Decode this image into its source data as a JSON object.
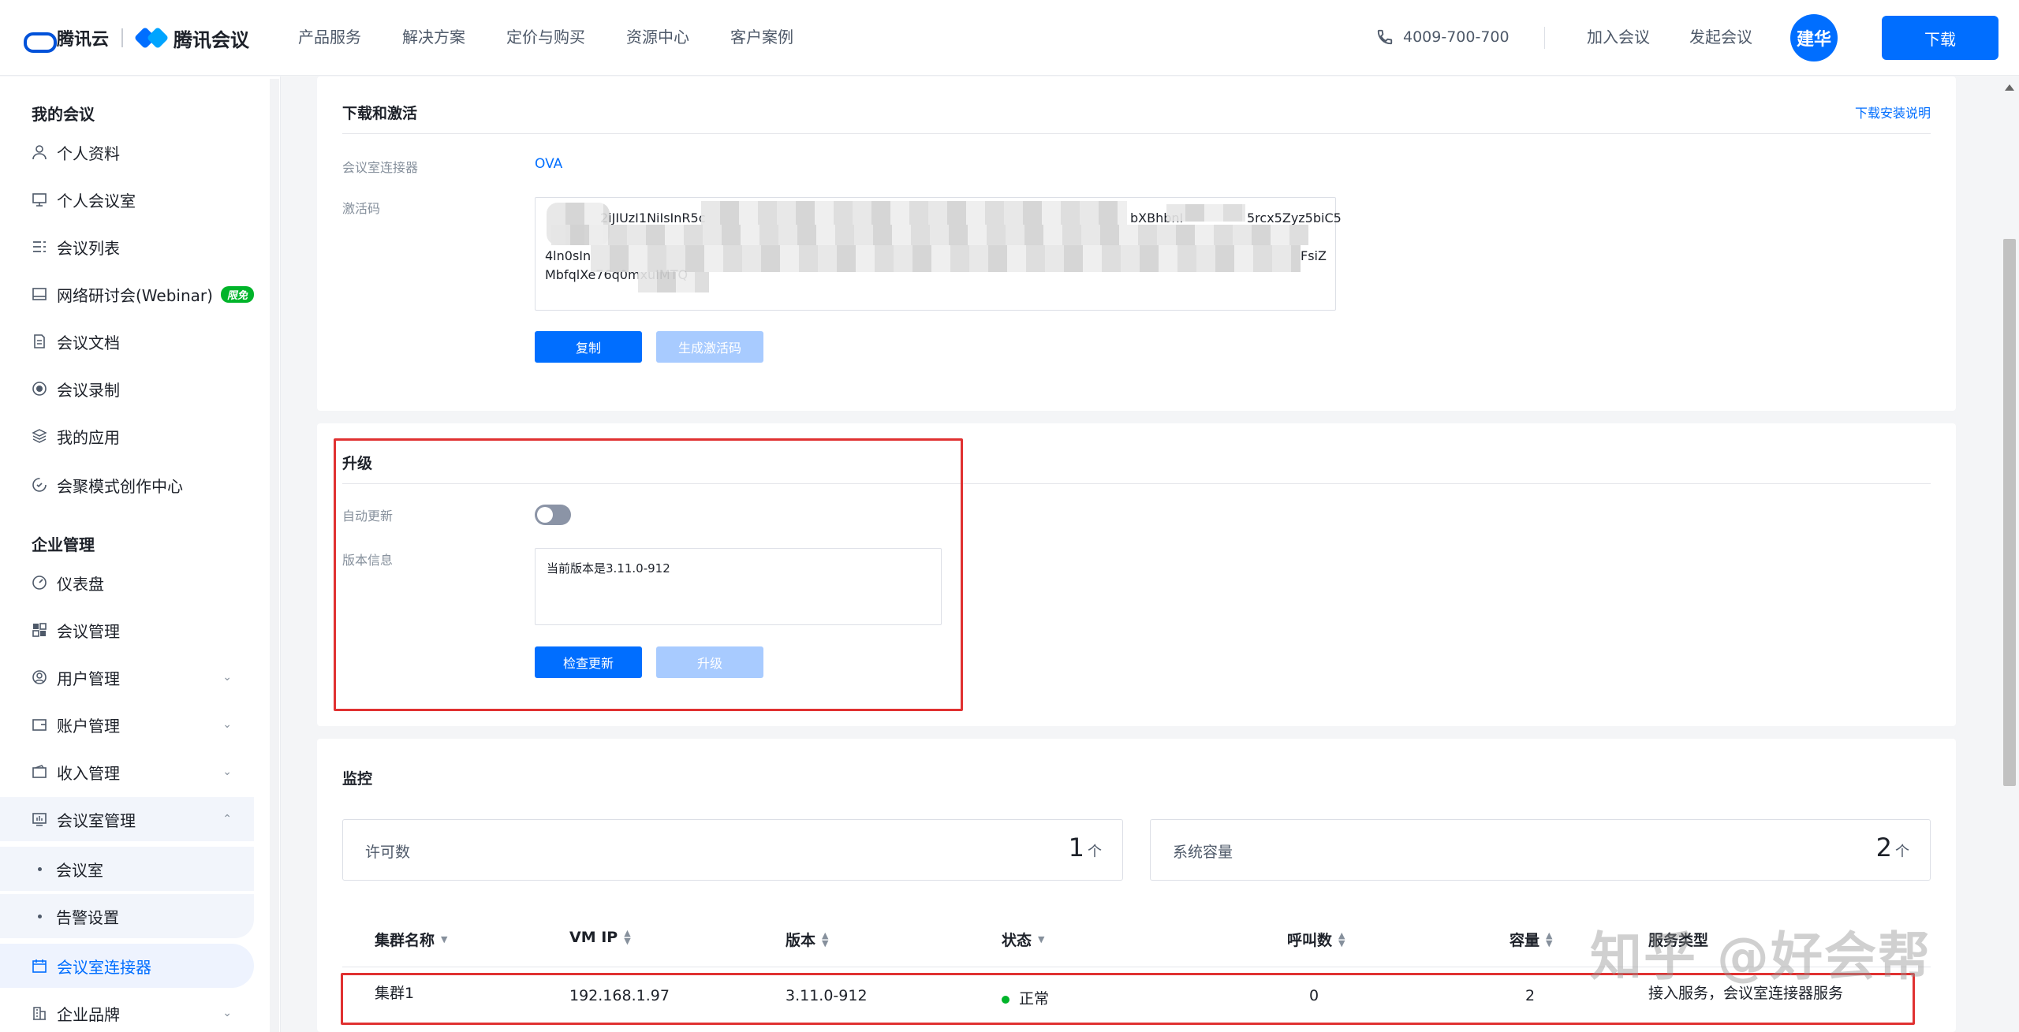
{
  "header": {
    "brand_cloud": "腾讯云",
    "brand_meeting": "腾讯会议",
    "nav": [
      "产品服务",
      "解决方案",
      "定价与购买",
      "资源中心",
      "客户案例"
    ],
    "phone": "4009-700-700",
    "join_meeting": "加入会议",
    "start_meeting": "发起会议",
    "avatar_text": "建华",
    "download": "下载"
  },
  "sidebar": {
    "group_my": "我的会议",
    "my_items": [
      {
        "label": "个人资料",
        "icon": "user-icon"
      },
      {
        "label": "个人会议室",
        "icon": "room-icon"
      },
      {
        "label": "会议列表",
        "icon": "list-icon"
      },
      {
        "label": "网络研讨会(Webinar)",
        "icon": "webinar-icon",
        "badge": "限免"
      },
      {
        "label": "会议文档",
        "icon": "document-icon"
      },
      {
        "label": "会议录制",
        "icon": "record-icon"
      },
      {
        "label": "我的应用",
        "icon": "apps-icon"
      },
      {
        "label": "会聚模式创作中心",
        "icon": "creative-icon"
      }
    ],
    "group_enterprise": "企业管理",
    "enterprise_items": [
      {
        "label": "仪表盘",
        "icon": "dashboard-icon"
      },
      {
        "label": "会议管理",
        "icon": "grid-icon"
      },
      {
        "label": "用户管理",
        "icon": "users-icon"
      },
      {
        "label": "账户管理",
        "icon": "wallet-icon"
      },
      {
        "label": "收入管理",
        "icon": "income-icon"
      },
      {
        "label": "会议室管理",
        "icon": "room-manage-icon"
      }
    ],
    "room_sub_items": [
      "会议室",
      "告警设置"
    ],
    "connector": "会议室连接器",
    "brand": "企业品牌"
  },
  "download_section": {
    "title": "下载和激活",
    "install_link": "下载安装说明",
    "connector_label": "会议室连接器",
    "connector_value": "OVA",
    "activation_label": "激活码",
    "code_line1_start": "2iJIUzI1NiIsInR5c",
    "code_line1_end": "bXBhbnI",
    "code_line1_tail": "5rcx5Zyz5biC5",
    "code_line3_start": "4ln0sIn",
    "code_line3_end": "FsiZ",
    "code_line4": "MbfqlXe76q0mxuIMTQ",
    "copy_btn": "复制",
    "generate_btn": "生成激活码"
  },
  "upgrade_section": {
    "title": "升级",
    "auto_update_label": "自动更新",
    "version_label": "版本信息",
    "version_text": "当前版本是3.11.0-912",
    "check_btn": "检查更新",
    "upgrade_btn": "升级"
  },
  "monitor_section": {
    "title": "监控",
    "license_label": "许可数",
    "license_value": "1",
    "capacity_label": "系统容量",
    "capacity_value": "2",
    "unit": "个",
    "columns": [
      "集群名称",
      "VM IP",
      "版本",
      "状态",
      "呼叫数",
      "容量",
      "服务类型"
    ],
    "rows": [
      {
        "name": "集群1",
        "ip": "192.168.1.97",
        "version": "3.11.0-912",
        "status": "正常",
        "calls": "0",
        "capacity": "2",
        "service": "接入服务，会议室连接器服务"
      }
    ]
  },
  "watermark": "知乎 @好会帮",
  "colors": {
    "accent": "#006eff",
    "highlight_box": "#e03131",
    "status_ok": "#00b42a"
  }
}
